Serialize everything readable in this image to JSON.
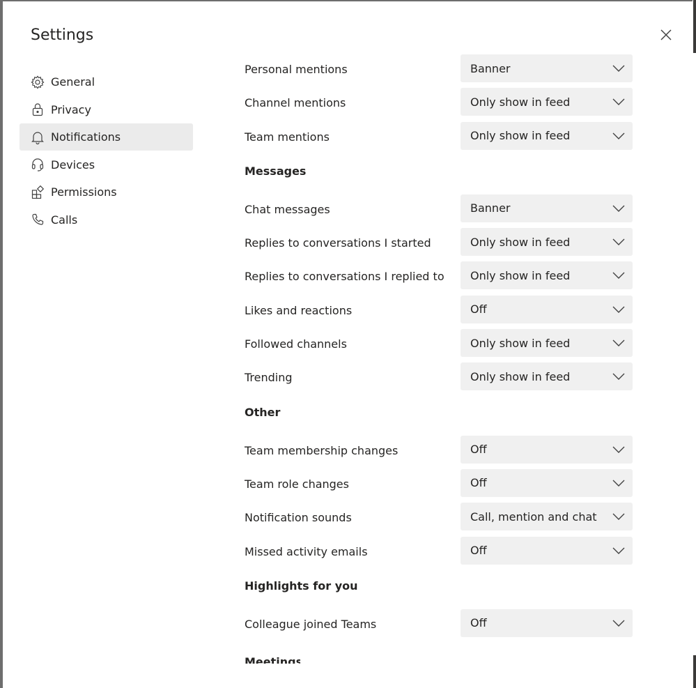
{
  "dialog": {
    "title": "Settings"
  },
  "nav": {
    "items": [
      {
        "label": "General",
        "icon": "gear-icon"
      },
      {
        "label": "Privacy",
        "icon": "lock-icon"
      },
      {
        "label": "Notifications",
        "icon": "bell-icon",
        "active": true
      },
      {
        "label": "Devices",
        "icon": "headset-icon"
      },
      {
        "label": "Permissions",
        "icon": "apps-icon"
      },
      {
        "label": "Calls",
        "icon": "phone-icon"
      }
    ]
  },
  "mentions": {
    "personal": {
      "label": "Personal mentions",
      "value": "Banner"
    },
    "channel": {
      "label": "Channel mentions",
      "value": "Only show in feed"
    },
    "team": {
      "label": "Team mentions",
      "value": "Only show in feed"
    }
  },
  "messages": {
    "heading": "Messages",
    "items": [
      {
        "label": "Chat messages",
        "value": "Banner"
      },
      {
        "label": "Replies to conversations I started",
        "value": "Only show in feed"
      },
      {
        "label": "Replies to conversations I replied to",
        "value": "Only show in feed"
      },
      {
        "label": "Likes and reactions",
        "value": "Off"
      },
      {
        "label": "Followed channels",
        "value": "Only show in feed"
      },
      {
        "label": "Trending",
        "value": "Only show in feed"
      }
    ]
  },
  "other": {
    "heading": "Other",
    "items": [
      {
        "label": "Team membership changes",
        "value": "Off"
      },
      {
        "label": "Team role changes",
        "value": "Off"
      },
      {
        "label": "Notification sounds",
        "value": "Call, mention and chat"
      },
      {
        "label": "Missed activity emails",
        "value": "Off"
      }
    ]
  },
  "highlights": {
    "heading": "Highlights for you",
    "items": [
      {
        "label": "Colleague joined Teams",
        "value": "Off"
      }
    ]
  },
  "next_section": {
    "heading": "Meetings"
  },
  "colors": {
    "selected_nav_bg": "#ebebeb",
    "select_bg": "#f0f0f0",
    "text": "#252423"
  }
}
